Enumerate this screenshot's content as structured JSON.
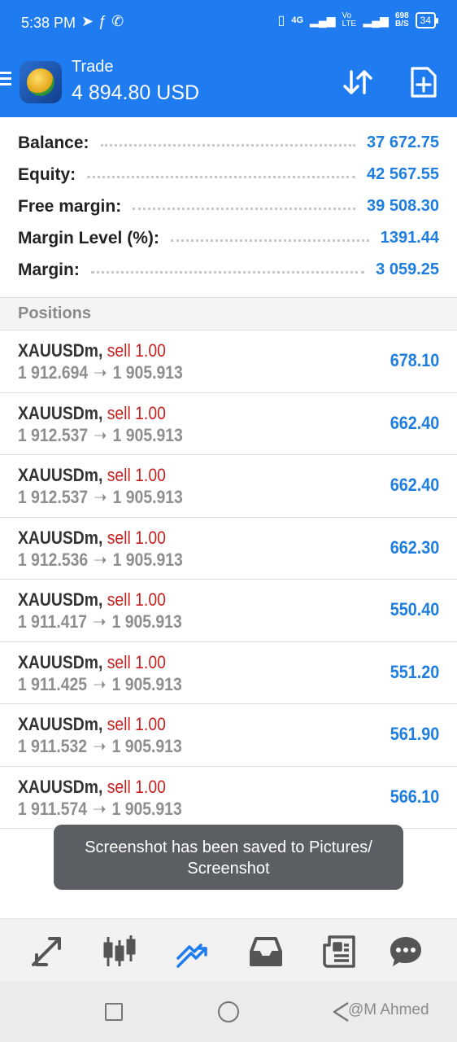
{
  "status_bar": {
    "time": "5:38 PM",
    "network": "4G",
    "volte": "Vo LTE",
    "speed_value": "698",
    "speed_unit": "B/S",
    "battery": "34"
  },
  "header": {
    "title": "Trade",
    "balance": "4 894.80 USD",
    "icons": [
      "menu-icon",
      "metatrader-logo",
      "sort-icon",
      "new-order-icon"
    ]
  },
  "summary": [
    {
      "label": "Balance:",
      "value": "37 672.75"
    },
    {
      "label": "Equity:",
      "value": "42 567.55"
    },
    {
      "label": "Free margin:",
      "value": "39 508.30"
    },
    {
      "label": "Margin Level (%):",
      "value": "1391.44"
    },
    {
      "label": "Margin:",
      "value": "3 059.25"
    }
  ],
  "positions_header": "Positions",
  "positions": [
    {
      "symbol": "XAUUSDm",
      "type": "sell 1.00",
      "open": "1 912.694",
      "current": "1 905.913",
      "profit": "678.10"
    },
    {
      "symbol": "XAUUSDm",
      "type": "sell 1.00",
      "open": "1 912.537",
      "current": "1 905.913",
      "profit": "662.40"
    },
    {
      "symbol": "XAUUSDm",
      "type": "sell 1.00",
      "open": "1 912.537",
      "current": "1 905.913",
      "profit": "662.40"
    },
    {
      "symbol": "XAUUSDm",
      "type": "sell 1.00",
      "open": "1 912.536",
      "current": "1 905.913",
      "profit": "662.30"
    },
    {
      "symbol": "XAUUSDm",
      "type": "sell 1.00",
      "open": "1 911.417",
      "current": "1 905.913",
      "profit": "550.40"
    },
    {
      "symbol": "XAUUSDm",
      "type": "sell 1.00",
      "open": "1 911.425",
      "current": "1 905.913",
      "profit": "551.20"
    },
    {
      "symbol": "XAUUSDm",
      "type": "sell 1.00",
      "open": "1 911.532",
      "current": "1 905.913",
      "profit": "561.90"
    },
    {
      "symbol": "XAUUSDm",
      "type": "sell 1.00",
      "open": "1 911.574",
      "current": "1 905.913",
      "profit": "566.10"
    }
  ],
  "toast": {
    "line1": "Screenshot has been saved to  Pictures/",
    "line2": "Screenshot"
  },
  "tabbar": {
    "active": "trade",
    "icons": [
      "quotes-icon",
      "chart-icon",
      "trade-icon",
      "history-icon",
      "news-icon",
      "chat-icon"
    ]
  },
  "watermark": "@M Ahmed",
  "colors": {
    "accent": "#1f7bf0",
    "profit": "#1e7ee0",
    "sell": "#c81e1e",
    "muted": "#8e8e8e"
  }
}
